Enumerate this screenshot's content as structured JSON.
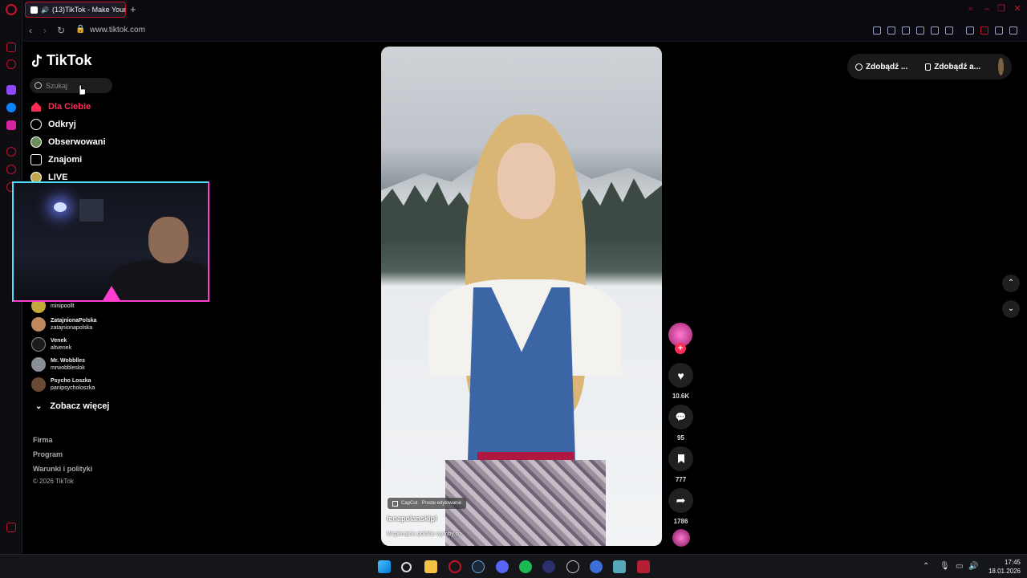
{
  "browser": {
    "tab_title": "(13)TikTok - Make Your",
    "new_tab": "+",
    "url": "www.tiktok.com"
  },
  "tiktok": {
    "logo": "TikTok",
    "search_placeholder": "Szukaj",
    "nav": [
      {
        "label": "Dla Ciebie",
        "icon": "home-icon",
        "active": true
      },
      {
        "label": "Odkryj",
        "icon": "compass-icon"
      },
      {
        "label": "Obserwowani",
        "icon": "following-icon"
      },
      {
        "label": "Znajomi",
        "icon": "friends-icon"
      },
      {
        "label": "LIVE",
        "icon": "live-icon"
      }
    ],
    "followed_accounts": [
      {
        "name": "",
        "handle": "minipoollt"
      },
      {
        "name": "ZatajnionaPolska",
        "handle": "zatajnionapolska"
      },
      {
        "name": "Venek",
        "handle": "altvenek"
      },
      {
        "name": "Mr. Wobblles",
        "handle": "mrwobbleslok"
      },
      {
        "name": "Psycho Loszka",
        "handle": "panipsycholoszka"
      }
    ],
    "see_more": "Zobacz więcej",
    "footer": {
      "firma": "Firma",
      "program": "Program",
      "terms": "Warunki i polityki",
      "copyright": "© 2026 TikTok"
    },
    "video": {
      "capcut_badge": "CapCut · Proste edytowanie",
      "author": "lenapolanskipl",
      "description": "Wspierajcie polskie wyroby.co"
    },
    "actions": {
      "likes": "10.6K",
      "comments": "95",
      "saves": "777",
      "shares": "1786"
    },
    "top_right": {
      "get_coins": "Zdobądź ...",
      "get_app": "Zdobądź a..."
    }
  },
  "taskbar": {
    "time": "17:45",
    "date": "18.01.2026"
  },
  "colors": {
    "tiktok_accent": "#fe2c55",
    "opera_red": "#c9122b"
  }
}
